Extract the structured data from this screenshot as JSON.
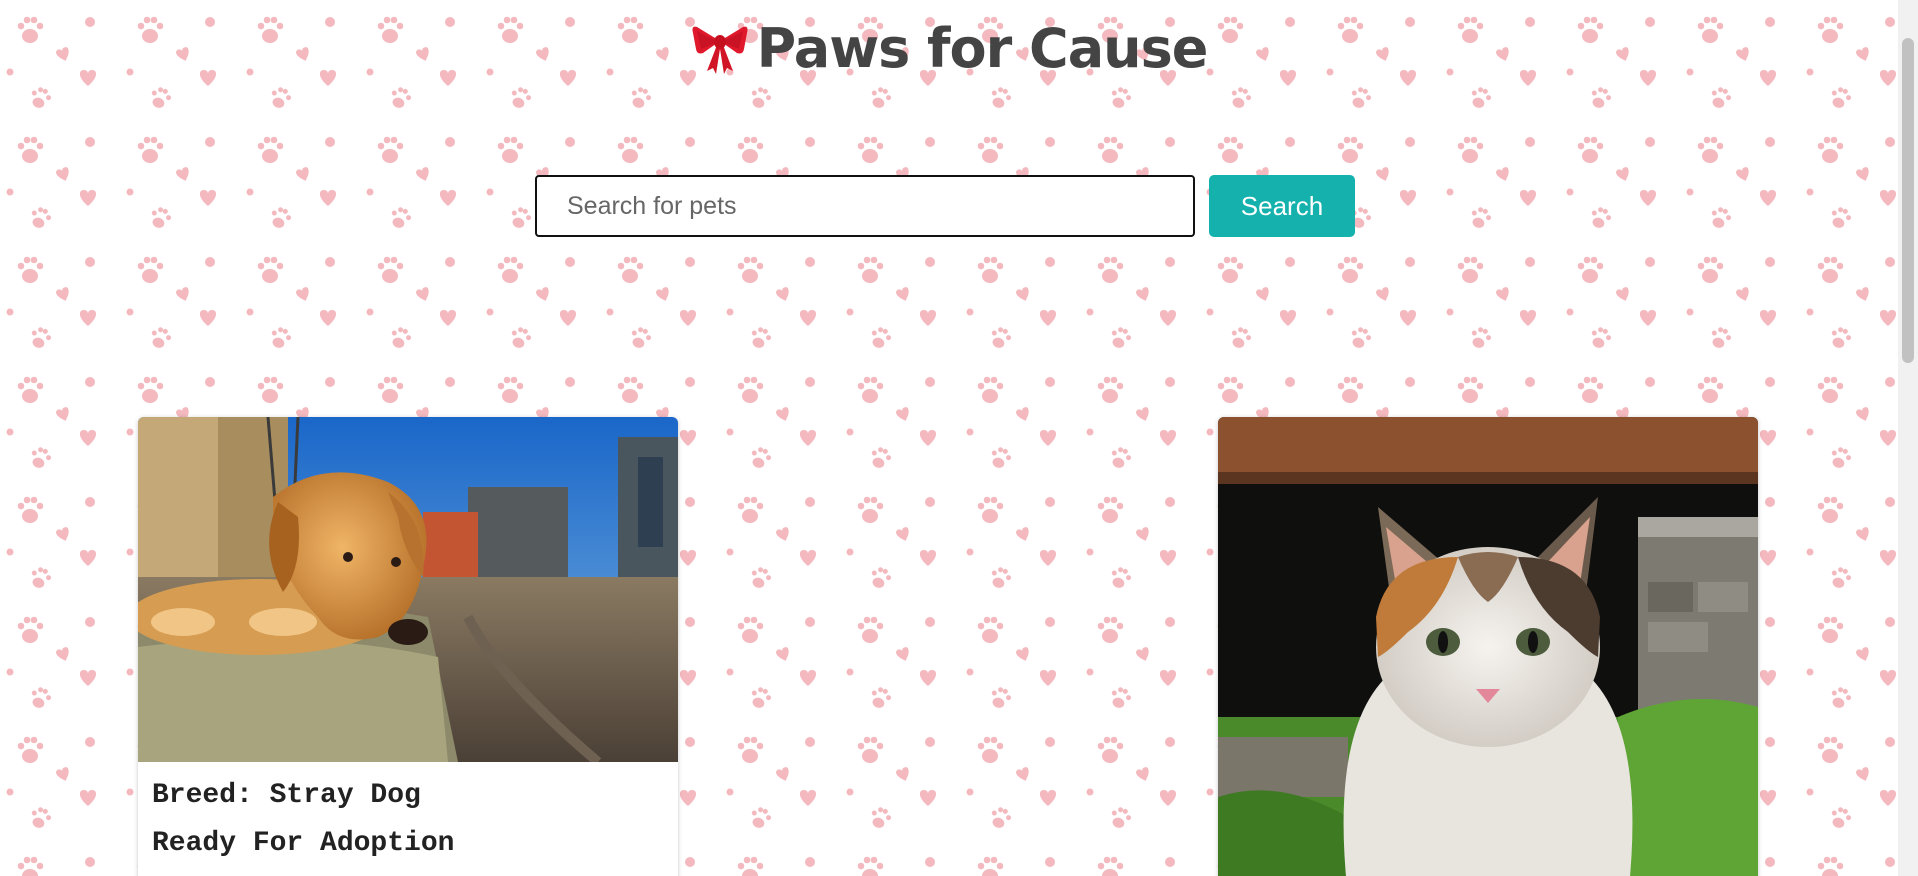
{
  "header": {
    "logo_icon": "ribbon-bow-icon",
    "title": "Paws for Cause"
  },
  "search": {
    "placeholder": "Search for pets",
    "value": "",
    "button_label": "Search"
  },
  "colors": {
    "accent": "#14b1ad",
    "title": "#444444",
    "pattern": "#f3b9be",
    "bow": "#e0182b"
  },
  "pets": [
    {
      "photo": "golden-dog-photo",
      "breed_line": "Breed: Stray Dog",
      "status": "Ready For Adoption"
    },
    {
      "photo": "calico-kitten-photo"
    }
  ]
}
